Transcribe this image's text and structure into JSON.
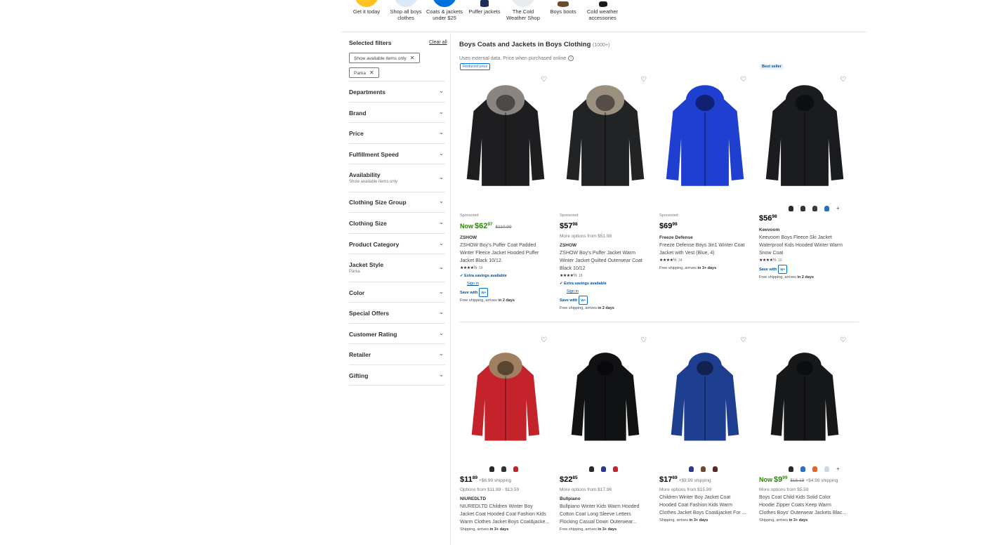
{
  "categories": [
    {
      "label": "Get it today",
      "color": "#ffc220"
    },
    {
      "label": "Shop all boys clothes",
      "color": "#dbe8f6"
    },
    {
      "label": "Coats & jackets under $25",
      "color": "#0071dc"
    },
    {
      "label": "Puffer jackets",
      "color": "#ffffff"
    },
    {
      "label": "The Cold Weather Shop",
      "color": "#e9ecef"
    },
    {
      "label": "Boys boots",
      "color": "#ffffff"
    },
    {
      "label": "Cold weather accessories",
      "color": "#ffffff"
    }
  ],
  "filters": {
    "selected_heading": "Selected filters",
    "clear_all": "Clear all",
    "chips": [
      "Show available items only",
      "Parka"
    ],
    "items": [
      {
        "label": "Departments",
        "sub": ""
      },
      {
        "label": "Brand",
        "sub": ""
      },
      {
        "label": "Price",
        "sub": ""
      },
      {
        "label": "Fulfillment Speed",
        "sub": ""
      },
      {
        "label": "Availability",
        "sub": "Show available items only"
      },
      {
        "label": "Clothing Size Group",
        "sub": ""
      },
      {
        "label": "Clothing Size",
        "sub": ""
      },
      {
        "label": "Product Category",
        "sub": ""
      },
      {
        "label": "Jacket Style",
        "sub": "Parka"
      },
      {
        "label": "Color",
        "sub": ""
      },
      {
        "label": "Special Offers",
        "sub": ""
      },
      {
        "label": "Customer Rating",
        "sub": ""
      },
      {
        "label": "Retailer",
        "sub": ""
      },
      {
        "label": "Gifting",
        "sub": ""
      }
    ]
  },
  "results": {
    "title": "Boys Coats and Jackets in Boys Clothing",
    "count": "(1000+)",
    "note": "Uses external data. Price when purchased online",
    "info_icon": "i",
    "heart_icon": "♡"
  },
  "tags": {
    "reduced": "Reduced price",
    "best": "Best seller"
  },
  "products": [
    {
      "sponsored": "Sponsored",
      "now": "Now",
      "dollars": "$62",
      "cents": "97",
      "was": "$110.99",
      "ship_fee": "",
      "more_options": "",
      "brand": "ZSHOW",
      "title_lines": [
        "ZSHOW Boy's Puffer Coat Padded",
        "Winter Fleece Jacket Hooded Puffer",
        "Jacket Black 10/12"
      ],
      "stars": "★★★★½",
      "review_count": "59",
      "extra_savings": "Extra savings available",
      "sign_in": "Sign in",
      "save_with": "Save with",
      "wplus": "W+",
      "shipping_text": "Free shipping, arrives ",
      "shipping_bold": "in 2 days",
      "jacket_color": "#1e1e20",
      "hood_fur": "#8a8580"
    },
    {
      "sponsored": "Sponsored",
      "now": "",
      "dollars": "$57",
      "cents": "98",
      "was": "",
      "ship_fee": "",
      "more_options": "More options from $51.98",
      "brand": "ZSHOW",
      "title_lines": [
        "ZSHOW Boy's Puffer Jacket Warm",
        "Winter Jacket Quilted Outerwear Coat",
        "Black 10/12"
      ],
      "stars": "★★★★½",
      "review_count": "18",
      "extra_savings": "Extra savings available",
      "sign_in": "Sign in",
      "save_with": "Save with",
      "wplus": "W+",
      "shipping_text": "Free shipping, arrives ",
      "shipping_bold": "in 2 days",
      "jacket_color": "#222325",
      "hood_fur": "#9b8f80"
    },
    {
      "sponsored": "Sponsored",
      "now": "",
      "dollars": "$69",
      "cents": "99",
      "was": "",
      "ship_fee": "",
      "more_options": "",
      "brand": "Freeze Defense",
      "title_lines": [
        "Freeze Defense Boys 3in1 Winter Coat",
        "Jacket with Vest (Blue, 4)"
      ],
      "stars": "★★★★½",
      "review_count": "34",
      "extra_savings": "",
      "sign_in": "",
      "save_with": "",
      "wplus": "",
      "shipping_text": "Free shipping, arrives ",
      "shipping_bold": "in 3+ days",
      "jacket_color": "#1f3fd0",
      "hood_fur": ""
    },
    {
      "sponsored": "",
      "now": "",
      "dollars": "$56",
      "cents": "98",
      "was": "",
      "ship_fee": "",
      "more_options": "",
      "brand": "Keevoom",
      "title_lines": [
        "Keevoom Boys Fleece Ski Jacket",
        "Waterproof Kids Hooded Winter Warm",
        "Snow Coat"
      ],
      "stars": "★★★★½",
      "review_count": "10",
      "extra_savings": "",
      "sign_in": "",
      "save_with": "Save with",
      "wplus": "W+",
      "shipping_text": "Free shipping, arrives ",
      "shipping_bold": "in 2 days",
      "jacket_color": "#1b1c1f",
      "hood_fur": "",
      "swatches": [
        "#2b2b2b",
        "#333333",
        "#3a3a3a",
        "#2f6fbf"
      ],
      "swatch_plus": "+"
    },
    {
      "sponsored": "",
      "now": "",
      "dollars": "$11",
      "cents": "89",
      "was": "",
      "ship_fee": "+$6.99 shipping",
      "more_options": "Options from $11.89 - $13.59",
      "brand": "NIUREDLTD",
      "title_lines": [
        "NIUREDLTD Children Winter Boy",
        "Jacket Coat Hooded Coat Fashion Kids",
        "Warm Clothes Jacket Boys Coat&jacke..."
      ],
      "stars": "",
      "review_count": "",
      "extra_savings": "",
      "sign_in": "",
      "save_with": "",
      "wplus": "",
      "shipping_text": "Shipping, arrives ",
      "shipping_bold": "in 3+ days",
      "jacket_color": "#c4232b",
      "hood_fur": "#a08060",
      "swatches": [
        "#2b2b2b",
        "#333333",
        "#c4232b"
      ],
      "swatch_plus": ""
    },
    {
      "sponsored": "",
      "now": "",
      "dollars": "$22",
      "cents": "85",
      "was": "",
      "ship_fee": "",
      "more_options": "More options from $17.96",
      "brand": "Bullpiano",
      "title_lines": [
        "Bullpiano Winter Kids Warm Hooded",
        "Cotton Coat Long Sleeve Letters",
        "Flocking Casual Down Outerwear..."
      ],
      "stars": "",
      "review_count": "",
      "extra_savings": "",
      "sign_in": "",
      "save_with": "",
      "wplus": "",
      "shipping_text": "Free shipping, arrives ",
      "shipping_bold": "in 3+ days",
      "jacket_color": "#111214",
      "hood_fur": "",
      "swatches": [
        "#2b2b2b",
        "#2b3a8a",
        "#c4232b"
      ],
      "swatch_plus": ""
    },
    {
      "sponsored": "",
      "now": "",
      "dollars": "$17",
      "cents": "69",
      "was": "",
      "ship_fee": "+$9.99 shipping",
      "more_options": "More options from $15.99",
      "brand": "",
      "title_lines": [
        "Children Winter Boy Jacket Coat",
        "Hooded Coat Fashion Kids Warm",
        "Clothes Jacket Boys Coat&jacket For ..."
      ],
      "stars": "",
      "review_count": "",
      "extra_savings": "",
      "sign_in": "",
      "save_with": "",
      "wplus": "",
      "shipping_text": "Shipping, arrives ",
      "shipping_bold": "in 3+ days",
      "jacket_color": "#1e3f8f",
      "hood_fur": "",
      "swatches": [
        "#2b3a8a",
        "#6b4a2e",
        "#5a2a2a"
      ],
      "swatch_plus": ""
    },
    {
      "sponsored": "",
      "now": "Now",
      "dollars": "$9",
      "cents": "99",
      "was": "$16.18",
      "ship_fee": "+$4.98 shipping",
      "more_options": "More options from $5.59",
      "brand": "",
      "title_lines": [
        "Boys Coat Child Kids Solid Color",
        "Hoodie Zipper Coats Keep Warm",
        "Clothes Boys' Outerwear Jackets Blac..."
      ],
      "stars": "",
      "review_count": "",
      "extra_savings": "",
      "sign_in": "",
      "save_with": "",
      "wplus": "",
      "shipping_text": "Shipping, arrives ",
      "shipping_bold": "in 3+ days",
      "jacket_color": "#17181a",
      "hood_fur": "",
      "swatches": [
        "#2b2b2b",
        "#2f6fbf",
        "#e8622a",
        "#cfd8e0"
      ],
      "swatch_plus": "+"
    }
  ]
}
